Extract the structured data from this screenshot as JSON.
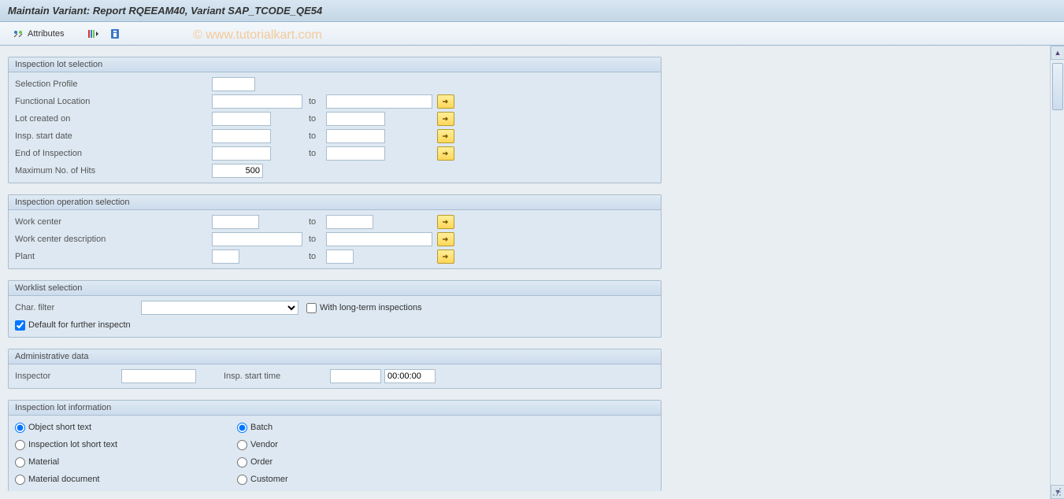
{
  "title": "Maintain Variant: Report RQEEAM40, Variant SAP_TCODE_QE54",
  "watermark": "© www.tutorialkart.com",
  "toolbar": {
    "attributes_label": "Attributes"
  },
  "groups": {
    "insp_lot_sel": {
      "header": "Inspection lot selection",
      "selection_profile": "Selection Profile",
      "functional_location": "Functional Location",
      "lot_created_on": "Lot created on",
      "insp_start_date": "Insp. start date",
      "end_of_inspection": "End of Inspection",
      "max_hits": "Maximum No. of Hits",
      "max_hits_value": "500",
      "to": "to"
    },
    "insp_op_sel": {
      "header": "Inspection operation selection",
      "work_center": "Work center",
      "work_center_desc": "Work center description",
      "plant": "Plant",
      "to": "to"
    },
    "worklist": {
      "header": "Worklist selection",
      "char_filter": "Char. filter",
      "long_term": "With long-term inspections",
      "default_further": "Default for further inspectn"
    },
    "admin": {
      "header": "Administrative data",
      "inspector": "Inspector",
      "insp_start_time": "Insp. start time",
      "time_value": "00:00:00"
    },
    "insp_lot_info": {
      "header": "Inspection lot information",
      "col1": {
        "object_short_text": "Object short text",
        "insp_lot_short_text": "Inspection lot short text",
        "material": "Material",
        "material_document": "Material document"
      },
      "col2": {
        "batch": "Batch",
        "vendor": "Vendor",
        "order": "Order",
        "customer": "Customer"
      }
    }
  }
}
